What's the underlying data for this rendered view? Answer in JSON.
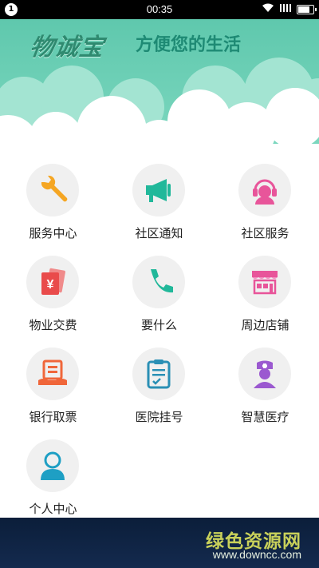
{
  "status": {
    "notification_badge": "1",
    "time": "00:35",
    "signal_icon": "signal-icon",
    "wifi_icon": "wifi-icon",
    "battery_icon": "battery-icon"
  },
  "banner": {
    "brand": "物诚宝",
    "slogan": "方便您的生活",
    "colors": {
      "sky": "#6fd1b6",
      "cloud_back": "#9ae2ce",
      "cloud_front": "#ffffff"
    }
  },
  "menu": {
    "items": [
      {
        "label": "服务中心",
        "icon": "wrench-icon"
      },
      {
        "label": "社区通知",
        "icon": "megaphone-icon"
      },
      {
        "label": "社区服务",
        "icon": "customer-service-icon"
      },
      {
        "label": "物业交费",
        "icon": "yuan-bill-icon"
      },
      {
        "label": "要什么",
        "icon": "phone-icon"
      },
      {
        "label": "周边店铺",
        "icon": "shop-icon"
      },
      {
        "label": "银行取票",
        "icon": "bank-ticket-icon"
      },
      {
        "label": "医院挂号",
        "icon": "clipboard-icon"
      },
      {
        "label": "智慧医疗",
        "icon": "nurse-icon"
      },
      {
        "label": "个人中心",
        "icon": "user-icon"
      }
    ]
  },
  "watermark": {
    "name": "绿色资源网",
    "url": "www.downcc.com"
  }
}
